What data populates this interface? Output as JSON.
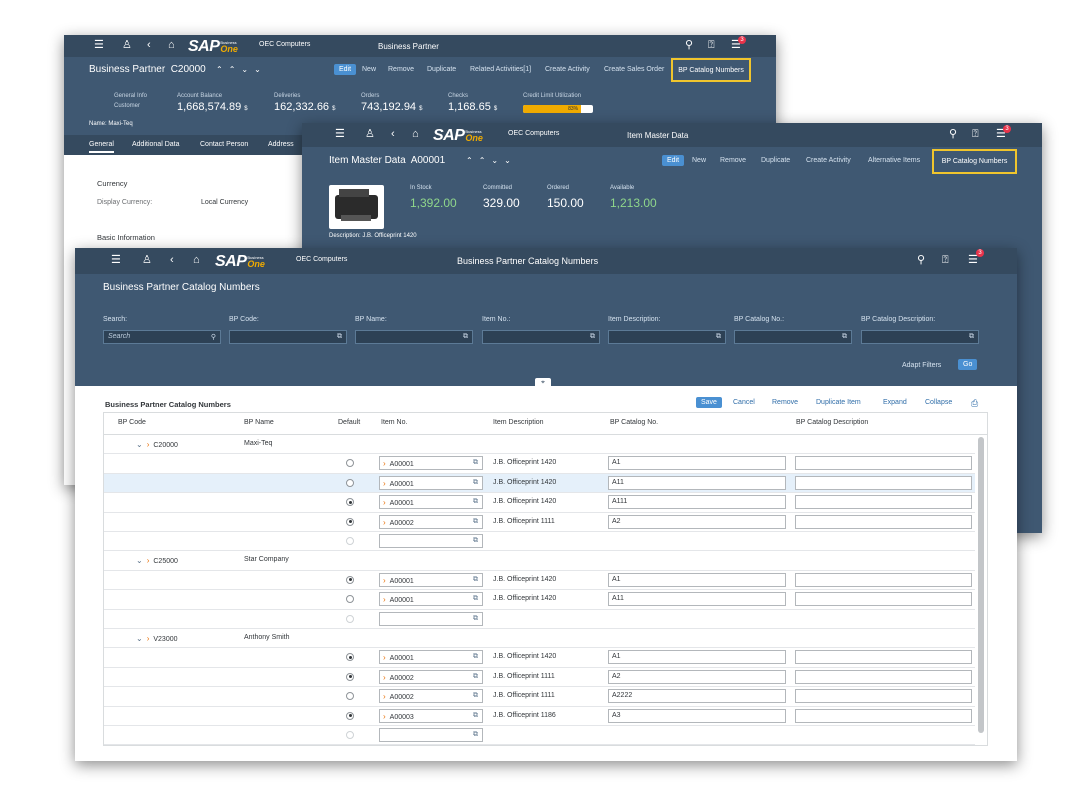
{
  "shell": {
    "company": "OEC Computers",
    "brand": "SAP",
    "brand_sub": "Business",
    "brand_one": "One",
    "badge": "3"
  },
  "bp_window": {
    "title": "Business Partner",
    "record": "Business Partner  C20000",
    "actions": [
      "Edit",
      "New",
      "Remove",
      "Duplicate",
      "Related Activities[1]",
      "Create Activity",
      "Create Sales Order"
    ],
    "highlight": "BP Catalog Numbers",
    "kpis": [
      {
        "label": "General Info",
        "sub": "Customer",
        "value": ""
      },
      {
        "label": "Account Balance",
        "value": "1,668,574.89",
        "unit": "$"
      },
      {
        "label": "Deliveries",
        "value": "162,332.66",
        "unit": "$"
      },
      {
        "label": "Orders",
        "value": "743,192.94",
        "unit": "$"
      },
      {
        "label": "Checks",
        "value": "1,168.65",
        "unit": "$"
      },
      {
        "label": "Credit Limit Utilization",
        "value": "83%",
        "fraction": 0.83
      }
    ],
    "name_label": "Name:",
    "name_value": "Maxi-Teq",
    "tabs": [
      "General",
      "Additional Data",
      "Contact Person",
      "Address"
    ],
    "body": {
      "currency": "Currency",
      "display_currency_label": "Display Currency:",
      "display_currency_value": "Local Currency",
      "basic_info": "Basic Information"
    }
  },
  "item_window": {
    "title": "Item Master Data",
    "record": "Item Master Data  A00001",
    "actions": [
      "Edit",
      "New",
      "Remove",
      "Duplicate",
      "Create Activity",
      "Alternative Items"
    ],
    "highlight": "BP Catalog Numbers",
    "kpis": [
      {
        "label": "In Stock",
        "value": "1,392.00",
        "green": true
      },
      {
        "label": "Committed",
        "value": "329.00",
        "green": false
      },
      {
        "label": "Ordered",
        "value": "150.00",
        "green": false
      },
      {
        "label": "Available",
        "value": "1,213.00",
        "green": true
      }
    ],
    "description_label": "Description:",
    "description_value": "J.B. Officeprint 1420"
  },
  "cat_window": {
    "title": "Business Partner Catalog Numbers",
    "page_title": "Business Partner Catalog Numbers",
    "filters": [
      {
        "label": "Search:",
        "placeholder": "Search"
      },
      {
        "label": "BP Code:",
        "placeholder": ""
      },
      {
        "label": "BP Name:",
        "placeholder": ""
      },
      {
        "label": "Item No.:",
        "placeholder": ""
      },
      {
        "label": "Item Description:",
        "placeholder": ""
      },
      {
        "label": "BP Catalog No.:",
        "placeholder": ""
      },
      {
        "label": "BP Catalog Description:",
        "placeholder": ""
      }
    ],
    "adapt_filters": "Adapt Filters",
    "go": "Go",
    "table_title": "Business Partner Catalog Numbers",
    "toolbar": [
      "Save",
      "Cancel",
      "Remove",
      "Duplicate Item",
      "Expand",
      "Collapse"
    ],
    "columns": [
      "BP Code",
      "BP Name",
      "Default",
      "Item No.",
      "Item Description",
      "BP Catalog No.",
      "BP Catalog Description"
    ],
    "groups": [
      {
        "code": "C20000",
        "name": "Maxi-Teq",
        "rows": [
          {
            "default": false,
            "item": "A00001",
            "desc": "J.B. Officeprint 1420",
            "cat": "A1",
            "cat_desc": ""
          },
          {
            "default": false,
            "item": "A00001",
            "desc": "J.B. Officeprint 1420",
            "cat": "A11",
            "cat_desc": "",
            "selected": true
          },
          {
            "default": true,
            "item": "A00001",
            "desc": "J.B. Officeprint 1420",
            "cat": "A111",
            "cat_desc": ""
          },
          {
            "default": true,
            "item": "A00002",
            "desc": "J.B. Officeprint 1111",
            "cat": "A2",
            "cat_desc": ""
          },
          {
            "empty": true
          }
        ]
      },
      {
        "code": "C25000",
        "name": "Star Company",
        "rows": [
          {
            "default": true,
            "item": "A00001",
            "desc": "J.B. Officeprint 1420",
            "cat": "A1",
            "cat_desc": ""
          },
          {
            "default": false,
            "item": "A00001",
            "desc": "J.B. Officeprint 1420",
            "cat": "A11",
            "cat_desc": ""
          },
          {
            "empty": true
          }
        ]
      },
      {
        "code": "V23000",
        "name": "Anthony Smith",
        "rows": [
          {
            "default": true,
            "item": "A00001",
            "desc": "J.B. Officeprint 1420",
            "cat": "A1",
            "cat_desc": ""
          },
          {
            "default": true,
            "item": "A00002",
            "desc": "J.B. Officeprint 1111",
            "cat": "A2",
            "cat_desc": ""
          },
          {
            "default": false,
            "item": "A00002",
            "desc": "J.B. Officeprint 1111",
            "cat": "A2222",
            "cat_desc": ""
          },
          {
            "default": true,
            "item": "A00003",
            "desc": "J.B. Officeprint 1186",
            "cat": "A3",
            "cat_desc": ""
          },
          {
            "empty": true
          }
        ]
      }
    ]
  }
}
